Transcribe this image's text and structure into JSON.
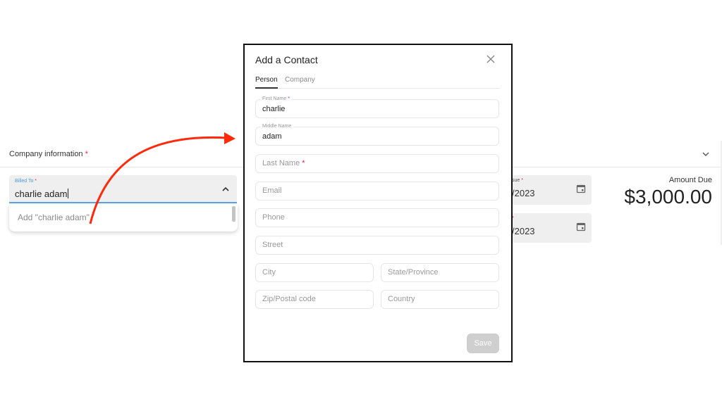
{
  "background": {
    "section_title": "Company information",
    "required_mark": "*",
    "billed_to": {
      "label": "Billed To",
      "value": "charlie adam"
    },
    "dropdown_option": "Add \"charlie adam\"",
    "date_fields": [
      {
        "label": "sue",
        "value": "/2023"
      },
      {
        "label": "",
        "value": "/2023"
      }
    ],
    "amount_due_label": "Amount Due",
    "amount_due_value": "$3,000.00"
  },
  "modal": {
    "title": "Add a Contact",
    "tabs": [
      {
        "label": "Person",
        "active": true
      },
      {
        "label": "Company",
        "active": false
      }
    ],
    "fields": {
      "first_name": {
        "label": "First Name",
        "value": "charlie",
        "required": true
      },
      "middle_name": {
        "label": "Middle Name",
        "value": "adam"
      },
      "last_name": {
        "placeholder": "Last Name",
        "required": true
      },
      "email": {
        "placeholder": "Email"
      },
      "phone": {
        "placeholder": "Phone"
      },
      "street": {
        "placeholder": "Street"
      },
      "city": {
        "placeholder": "City"
      },
      "state": {
        "placeholder": "State/Province"
      },
      "zip": {
        "placeholder": "Zip/Postal code"
      },
      "country": {
        "placeholder": "Country"
      }
    },
    "save_label": "Save"
  },
  "annotation": {
    "arrow_color": "#ff2a0a"
  },
  "colors": {
    "focus_blue": "#5aa3e6",
    "required_red": "#e0245e"
  }
}
